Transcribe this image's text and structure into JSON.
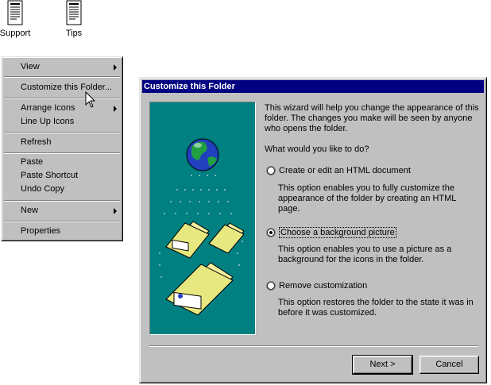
{
  "desktop": {
    "icons": [
      {
        "label": "Support"
      },
      {
        "label": "Tips"
      }
    ]
  },
  "context_menu": {
    "items": [
      {
        "label": "View",
        "submenu": true
      },
      {
        "label": "Customize this Folder..."
      },
      {
        "label": "Arrange Icons",
        "submenu": true
      },
      {
        "label": "Line Up Icons"
      },
      {
        "label": "Refresh"
      },
      {
        "label": "Paste"
      },
      {
        "label": "Paste Shortcut"
      },
      {
        "label": "Undo Copy"
      },
      {
        "label": "New",
        "submenu": true
      },
      {
        "label": "Properties"
      }
    ]
  },
  "dialog": {
    "title": "Customize this Folder",
    "intro_line1": "This wizard will help you change the appearance of this",
    "intro_line2": "folder.  The changes you make will be seen by anyone",
    "intro_line3": "who opens the folder.",
    "question": "What would you like to do?",
    "options": [
      {
        "label": "Create or edit an HTML document",
        "selected": false,
        "desc": [
          "This option enables you to fully customize the",
          "appearance of the folder by creating an HTML",
          "page."
        ]
      },
      {
        "label": "Choose a background picture",
        "selected": true,
        "desc": [
          "This option enables you to use a picture as a",
          "background for the icons in the folder."
        ]
      },
      {
        "label": "Remove customization",
        "selected": false,
        "desc": [
          "This option restores the folder to the state it was in",
          "before it was customized."
        ]
      }
    ],
    "buttons": {
      "next": "Next >",
      "cancel": "Cancel"
    }
  },
  "colors": {
    "title_bar": "#000080",
    "face": "#c0c0c0",
    "art_bg": "#008080"
  }
}
